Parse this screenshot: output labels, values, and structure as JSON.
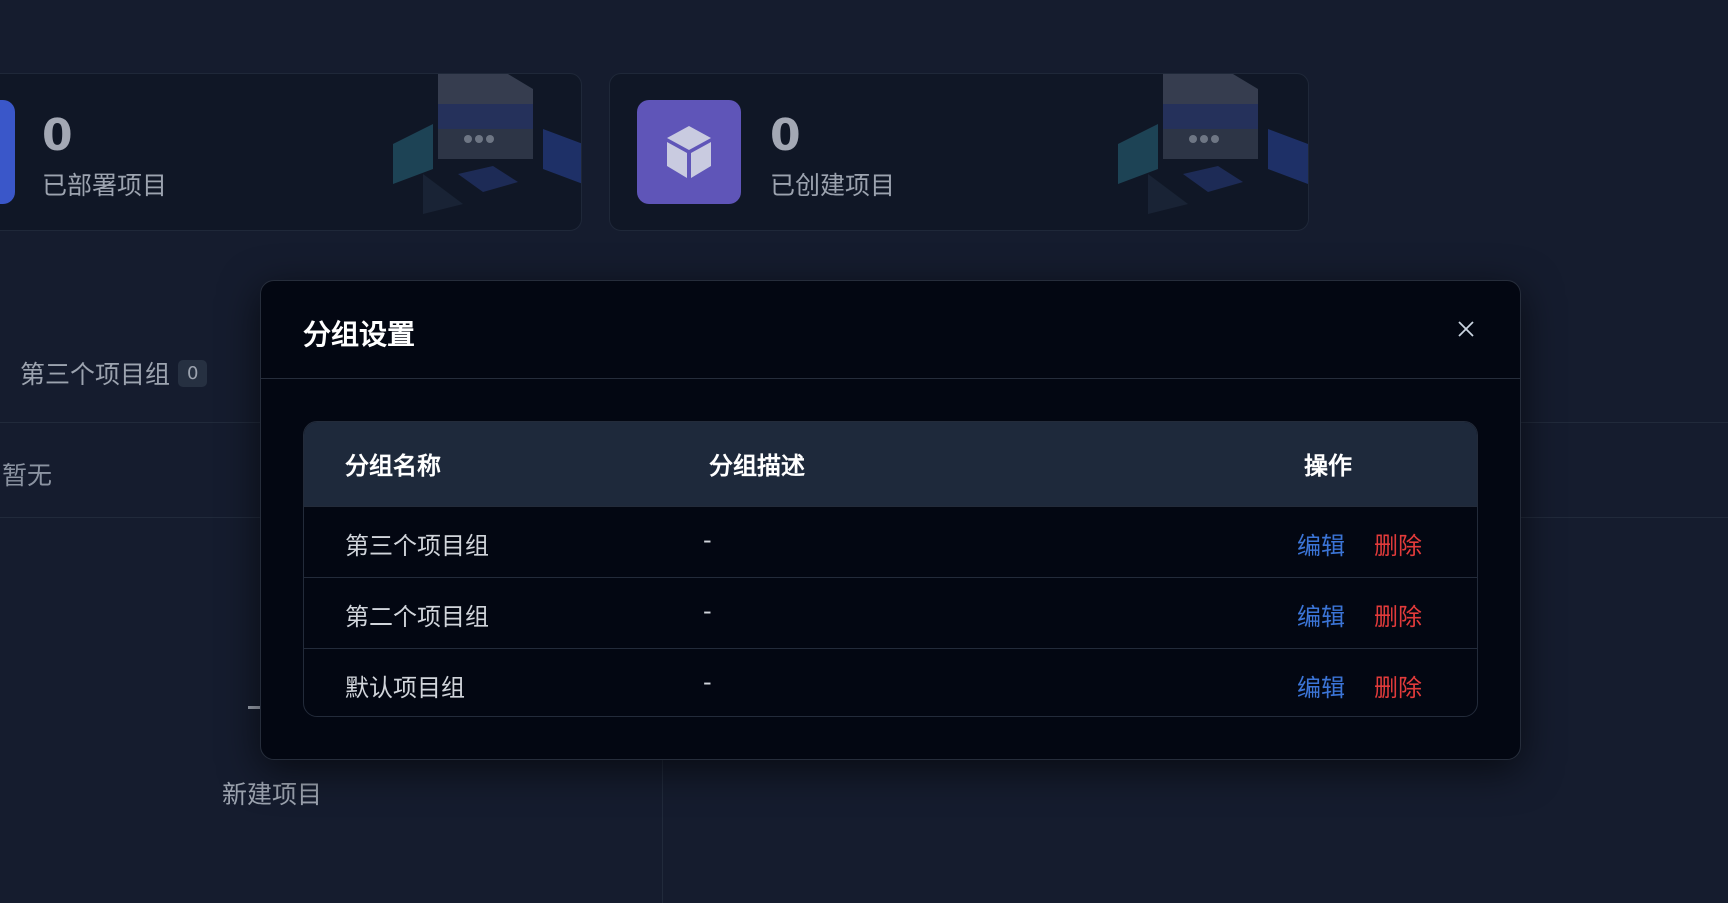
{
  "stats": [
    {
      "value": "0",
      "label": "已部署项目",
      "icon": "rocket-icon",
      "color": "#3a57c9"
    },
    {
      "value": "0",
      "label": "已创建项目",
      "icon": "cube-icon",
      "color": "#5f55b8"
    }
  ],
  "group_tab": {
    "label": "第三个项目组",
    "count": "0"
  },
  "empty_text": "暂无",
  "new_project_label": "新建项目",
  "modal": {
    "title": "分组设置",
    "columns": {
      "name": "分组名称",
      "description": "分组描述",
      "actions": "操作"
    },
    "rows": [
      {
        "name": "第三个项目组",
        "description": "-",
        "edit": "编辑",
        "delete": "删除"
      },
      {
        "name": "第二个项目组",
        "description": "-",
        "edit": "编辑",
        "delete": "删除"
      },
      {
        "name": "默认项目组",
        "description": "-",
        "edit": "编辑",
        "delete": "删除"
      }
    ]
  },
  "colors": {
    "edit": "#3b74d6",
    "delete": "#e23b3b",
    "accent": "#5f55b8"
  }
}
